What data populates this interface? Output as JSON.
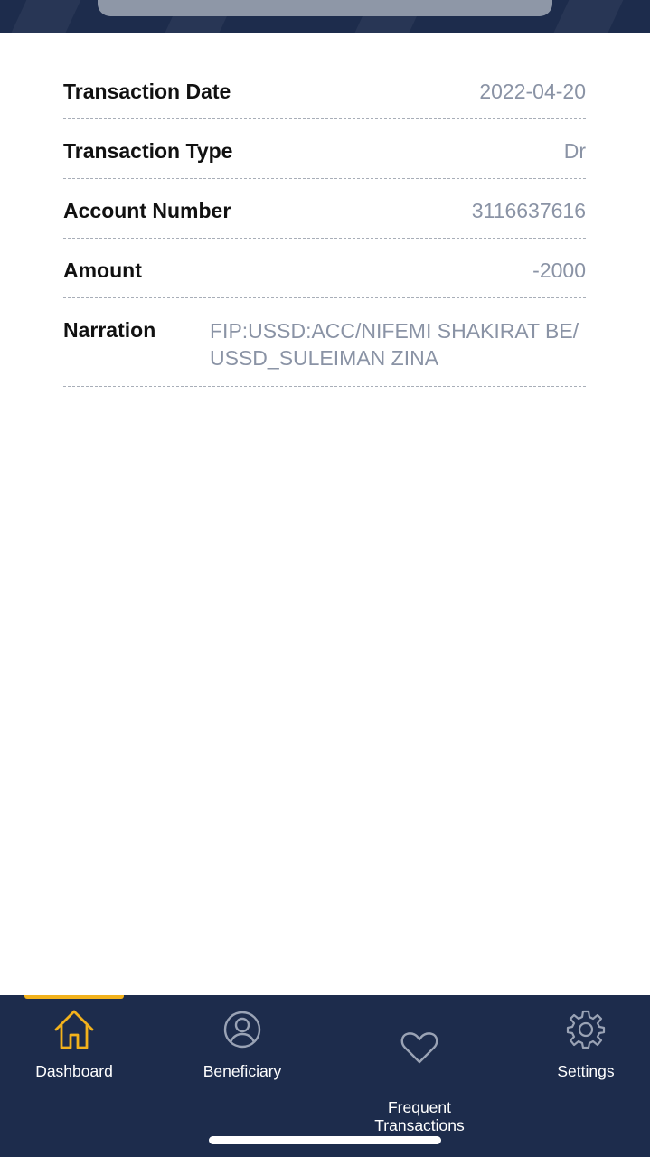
{
  "details": [
    {
      "label": "Transaction Date",
      "value": "2022-04-20"
    },
    {
      "label": "Transaction Type",
      "value": "Dr"
    },
    {
      "label": "Account Number",
      "value": "3116637616"
    },
    {
      "label": "Amount",
      "value": "-2000"
    },
    {
      "label": "Narration",
      "value": "FIP:USSD:ACC/NIFEMI SHAKIRAT BE/ USSD_SULEIMAN ZINA"
    }
  ],
  "nav": {
    "items": [
      {
        "label": "Dashboard",
        "icon": "home-icon",
        "active": true
      },
      {
        "label": "Beneficiary",
        "icon": "user-icon",
        "active": false
      },
      {
        "label": "Frequent\nTransactions",
        "icon": "heart-icon",
        "active": false
      },
      {
        "label": "Settings",
        "icon": "gear-icon",
        "active": false
      }
    ]
  },
  "colors": {
    "nav_background": "#1d2c4c",
    "active_accent": "#f2b21c",
    "value_text": "#8a93a5",
    "icon_inactive": "#9aa3b5"
  }
}
